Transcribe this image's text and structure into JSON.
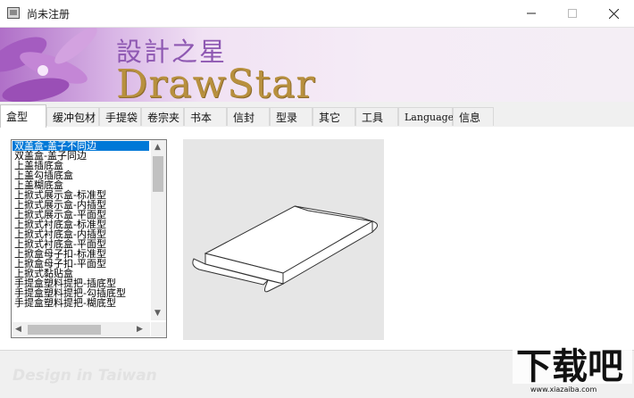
{
  "window": {
    "title": "尚未注册"
  },
  "banner": {
    "title_cn": "設計之星",
    "title_en": "DrawStar"
  },
  "tabs": [
    "盒型",
    "缓冲包材",
    "手提袋",
    "卷宗夹",
    "书本",
    "信封",
    "型录",
    "其它",
    "工具",
    "Language",
    "信息"
  ],
  "active_tab": "盒型",
  "list": {
    "items": [
      "双盖盒-盖子不同边",
      "双盖盒-盖子同边",
      "上盖插底盒",
      "上盖勾插底盒",
      "上盖糊底盒",
      "上掀式展示盒-标准型",
      "上掀式展示盒-内插型",
      "上掀式展示盒-平面型",
      "上掀式衬底盒-标准型",
      "上掀式衬底盒-内插型",
      "上掀式衬底盒-平面型",
      "上掀盒母子扣-标准型",
      "上掀盒母子扣-平面型",
      "上掀式黏贴盒",
      "手提盒塑料提把-插底型",
      "手提盒塑料提把-勾插底型",
      "手提盒塑料提把-糊底型"
    ],
    "selected_index": 0
  },
  "preview": {
    "icon": "box-3d-outline"
  },
  "footer": {
    "text": "Design in Taiwan"
  },
  "watermark": {
    "text": "下载吧",
    "url_text": "www.xiazaiba.com"
  },
  "colors": {
    "selection": "#0078d7",
    "banner_purple": "#8e58b2",
    "banner_gold": "#b8903e"
  }
}
